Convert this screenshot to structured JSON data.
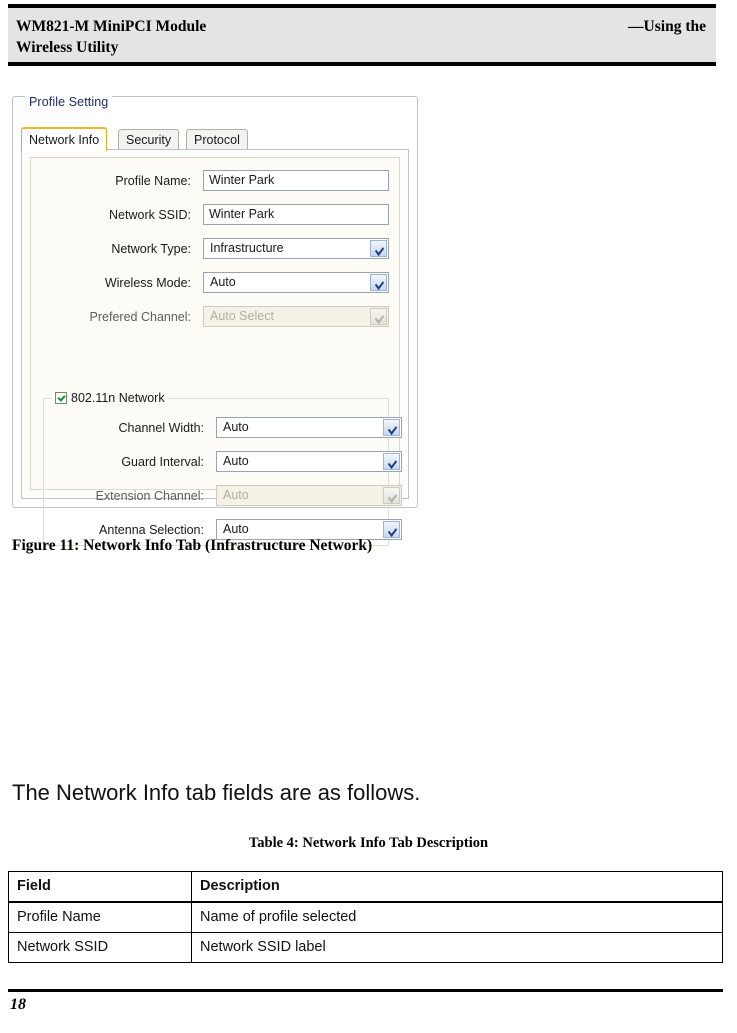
{
  "header": {
    "left_title": "WM821-M MiniPCI Module Wireless Utility",
    "left_line1": "WM821-M MiniPCI Module",
    "left_line2": "Wireless Utility",
    "right_title": "—Using the"
  },
  "figure": {
    "groupbox_legend": "Profile Setting",
    "tabs": [
      {
        "label": "Network Info",
        "active": true
      },
      {
        "label": "Security",
        "active": false
      },
      {
        "label": "Protocol",
        "active": false
      }
    ],
    "fields": [
      {
        "label": "Profile Name:",
        "value": "Winter Park",
        "type": "text",
        "disabled": false
      },
      {
        "label": "Network SSID:",
        "value": "Winter Park",
        "type": "text",
        "disabled": false
      },
      {
        "label": "Network Type:",
        "value": "Infrastructure",
        "type": "combo",
        "disabled": false
      },
      {
        "label": "Wireless Mode:",
        "value": "Auto",
        "type": "combo",
        "disabled": false
      },
      {
        "label": "Prefered Channel:",
        "value": "Auto Select",
        "type": "combo",
        "disabled": true
      }
    ],
    "subgroup": {
      "legend": "802.11n Network",
      "checked": true,
      "fields": [
        {
          "label": "Channel Width:",
          "value": "Auto",
          "type": "combo",
          "disabled": false
        },
        {
          "label": "Guard Interval:",
          "value": "Auto",
          "type": "combo",
          "disabled": false
        },
        {
          "label": "Extension Channel:",
          "value": "Auto",
          "type": "combo",
          "disabled": true
        },
        {
          "label": "Antenna Selection:",
          "value": "Auto",
          "type": "combo",
          "disabled": false
        }
      ]
    },
    "caption": "Figure 11: Network Info Tab (Infrastructure Network)"
  },
  "body": {
    "paragraph": "The Network Info tab fields are as follows."
  },
  "table": {
    "title": "Table 4: Network Info Tab Description",
    "headers": [
      "Field",
      "Description"
    ],
    "rows": [
      [
        "Profile Name",
        "Name of profile selected"
      ],
      [
        "Network SSID",
        "Network SSID label"
      ]
    ]
  },
  "footer": {
    "page_number": "18"
  },
  "colors": {
    "header_bg": "#e4e4e4",
    "legend_text": "#1b2d6b",
    "active_tab_accent": "#f0b429",
    "checkbox_check": "#1f8a3a",
    "combo_button": "#c8d8f2"
  }
}
